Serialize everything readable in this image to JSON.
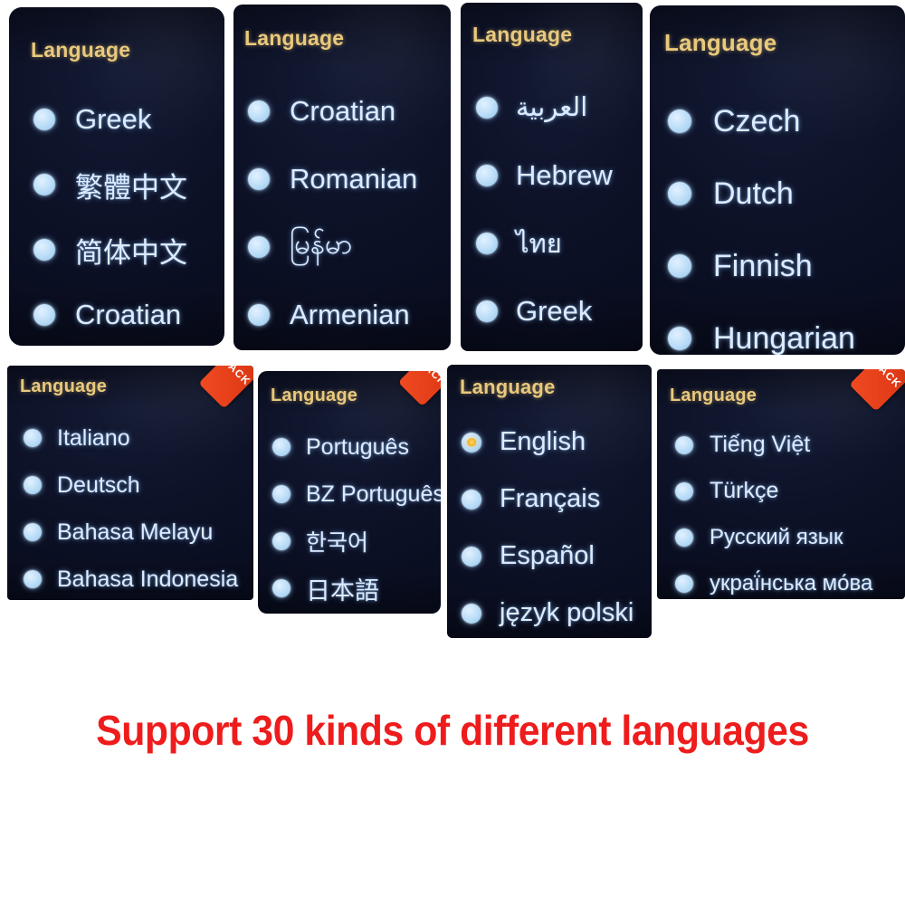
{
  "caption": "Support 30 kinds of different languages",
  "colors": {
    "title": "#e9c97e",
    "label": "#dcebff",
    "radio": "#b9dcf7",
    "radio_selected": "#f0ae2a",
    "ribbon": "#e23d18",
    "caption": "#ee1c1c",
    "screen_bg": "#0d1228"
  },
  "back_label": "BACK",
  "panels": [
    {
      "id": "panel-1",
      "title": "Language",
      "has_back": false,
      "items": [
        {
          "label": "Greek",
          "selected": false
        },
        {
          "label": "繁體中文",
          "selected": false
        },
        {
          "label": "简体中文",
          "selected": false
        },
        {
          "label": "Croatian",
          "selected": false
        }
      ]
    },
    {
      "id": "panel-2",
      "title": "Language",
      "has_back": false,
      "items": [
        {
          "label": "Croatian",
          "selected": false
        },
        {
          "label": "Romanian",
          "selected": false
        },
        {
          "label": "မြန်မာ",
          "selected": false
        },
        {
          "label": "Armenian",
          "selected": false
        }
      ]
    },
    {
      "id": "panel-3",
      "title": "Language",
      "has_back": false,
      "items": [
        {
          "label": "العربية",
          "selected": false
        },
        {
          "label": "Hebrew",
          "selected": false
        },
        {
          "label": "ไทย",
          "selected": false
        },
        {
          "label": "Greek",
          "selected": false
        }
      ]
    },
    {
      "id": "panel-4",
      "title": "Language",
      "has_back": false,
      "items": [
        {
          "label": "Czech",
          "selected": false
        },
        {
          "label": "Dutch",
          "selected": false
        },
        {
          "label": "Finnish",
          "selected": false
        },
        {
          "label": "Hungarian",
          "selected": false
        }
      ]
    },
    {
      "id": "panel-5",
      "title": "Language",
      "has_back": true,
      "items": [
        {
          "label": "Italiano",
          "selected": false
        },
        {
          "label": "Deutsch",
          "selected": false
        },
        {
          "label": "Bahasa Melayu",
          "selected": false
        },
        {
          "label": "Bahasa Indonesia",
          "selected": false
        }
      ]
    },
    {
      "id": "panel-6",
      "title": "Language",
      "has_back": true,
      "items": [
        {
          "label": "Português",
          "selected": false
        },
        {
          "label": "BZ Português",
          "selected": false
        },
        {
          "label": "한국어",
          "selected": false
        },
        {
          "label": "日本語",
          "selected": false
        }
      ]
    },
    {
      "id": "panel-7",
      "title": "Language",
      "has_back": false,
      "items": [
        {
          "label": "English",
          "selected": true
        },
        {
          "label": "Français",
          "selected": false
        },
        {
          "label": "Español",
          "selected": false
        },
        {
          "label": "język polski",
          "selected": false
        }
      ]
    },
    {
      "id": "panel-8",
      "title": "Language",
      "has_back": true,
      "items": [
        {
          "label": "Tiếng Việt",
          "selected": false
        },
        {
          "label": "Türkçe",
          "selected": false
        },
        {
          "label": "Русский язык",
          "selected": false
        },
        {
          "label": "украї́нська мо́ва",
          "selected": false
        }
      ]
    }
  ]
}
